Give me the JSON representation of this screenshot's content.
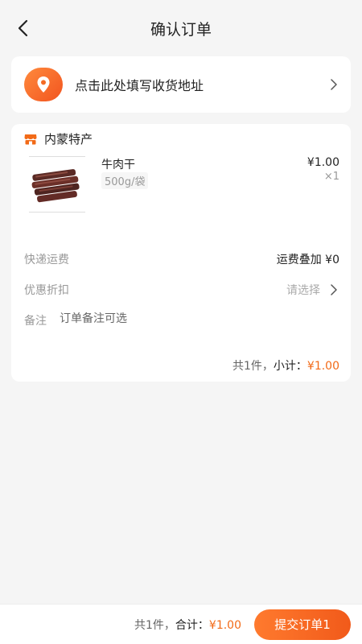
{
  "header": {
    "title": "确认订单"
  },
  "address": {
    "prompt": "点击此处填写收货地址"
  },
  "shop": {
    "name": "内蒙特产",
    "product": {
      "name": "牛肉干",
      "spec": "500g/袋",
      "price": "¥1.00",
      "qty": "×1"
    }
  },
  "shipping": {
    "label": "快递运费",
    "value": "运费叠加 ¥0"
  },
  "discount": {
    "label": "优惠折扣",
    "placeholder": "请选择"
  },
  "remark": {
    "label": "备注",
    "placeholder": "订单备注可选"
  },
  "subtotal": {
    "count": "共1件，",
    "label": "小计：",
    "amount": "¥1.00"
  },
  "footer": {
    "count": "共1件，",
    "label": "合计：",
    "amount": "¥1.00",
    "submit": "提交订单1"
  },
  "colors": {
    "accent": "#f26a17",
    "background": "#f5f5f5"
  },
  "icons": {
    "back": "chevron-left-icon",
    "location": "location-pin-icon",
    "shop": "store-icon"
  }
}
